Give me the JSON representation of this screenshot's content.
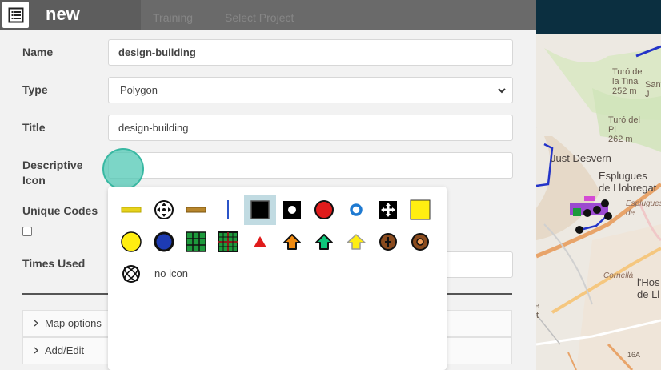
{
  "header": {
    "app_title": "new",
    "tabs": [
      "Training",
      "Select Project"
    ]
  },
  "form": {
    "name_label": "Name",
    "name_value": "design-building",
    "type_label": "Type",
    "type_value": "Polygon",
    "title_label": "Title",
    "title_value": "design-building",
    "descriptive_icon_label": "Descriptive\nIcon",
    "descriptive_icon_value": "",
    "unique_codes_label": "Unique Codes",
    "unique_codes_checked": false,
    "times_used_label": "Times Used",
    "times_used_value": ""
  },
  "accordion": [
    {
      "label": "Map options",
      "expanded": false
    },
    {
      "label": "Add/Edit",
      "expanded": false
    }
  ],
  "icon_picker": {
    "icons": [
      "yellow-line-icon",
      "arrows-cross-circle-icon",
      "brown-line-icon",
      "blue-vertical-line-icon",
      "black-square-icon",
      "black-square-white-dot-icon",
      "red-circle-icon",
      "blue-ring-icon",
      "arrows-cross-square-icon",
      "yellow-square-icon",
      "yellow-circle-icon",
      "blue-circle-icon",
      "green-grid-icon",
      "green-grid-red-border-icon",
      "red-triangle-icon",
      "orange-house-icon",
      "green-house-icon",
      "yellow-house-icon",
      "brown-circle-cross-icon",
      "brown-circle-ring-icon"
    ],
    "selected_index": 4,
    "no_icon_label": "no icon"
  },
  "map": {
    "labels": {
      "turo_la_tina": "Turó de\nla Tina\n252 m",
      "sant": "Sant\nJ",
      "turo_del_pi": "Turó del\nPi\n262 m",
      "just_desvern": "Just Desvern",
      "esplugues": "Esplugues\nde Llobregat",
      "esplugues_it": "Esplugues\nde",
      "cornella": "Cornellà",
      "hospitalet": "l'Hos\nde Ll",
      "cornella_lobregat": "llà de\nregat",
      "road": "16A"
    }
  },
  "colors": {
    "header_bg": "#5d5d5d",
    "panel_bg": "#f2f2f2",
    "selected_icon_bg": "#c1dbe2",
    "focus_ring": "#38b8a2"
  }
}
